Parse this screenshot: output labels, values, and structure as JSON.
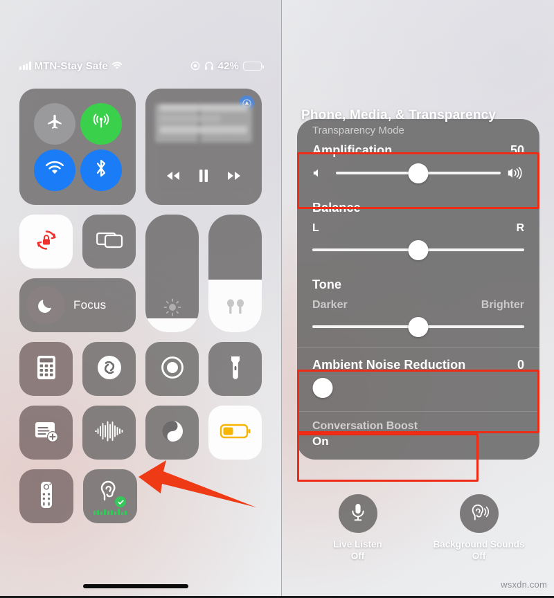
{
  "status_bar": {
    "carrier": "MTN-Stay Safe",
    "signal_icon": "cellular-signal-bars-icon",
    "wifi_icon": "wifi-icon",
    "record_icon": "screen-record-indicator-icon",
    "headphones_icon": "headphones-icon",
    "battery_percent": "42%",
    "battery_level": 42,
    "battery_color": "#fdc500"
  },
  "control_center": {
    "connectivity": {
      "airplane": {
        "name": "airplane-mode",
        "icon": "airplane-icon",
        "state": "off"
      },
      "cellular": {
        "name": "cellular-data",
        "icon": "cellular-antenna-icon",
        "state": "on"
      },
      "wifi": {
        "name": "wifi",
        "icon": "wifi-icon",
        "state": "on"
      },
      "bluetooth": {
        "name": "bluetooth",
        "icon": "bluetooth-icon",
        "state": "on"
      }
    },
    "media": {
      "airplay_icon": "airplay-audio-icon",
      "rewind_icon": "rewind-icon",
      "pause_icon": "pause-icon",
      "forward_icon": "fast-forward-icon",
      "artwork": "blurred-now-playing-artwork"
    },
    "rotation_lock": {
      "icon": "rotation-lock-icon",
      "state": "on"
    },
    "screen_mirroring": {
      "icon": "screen-mirroring-icon",
      "state": "off"
    },
    "focus": {
      "label": "Focus",
      "icon": "moon-icon",
      "state": "off"
    },
    "brightness": {
      "icon": "brightness-sun-icon",
      "level": 12
    },
    "volume": {
      "icon": "airpods-icon",
      "level": 45
    },
    "tiles": [
      {
        "label": "Calculator",
        "icon": "calculator-icon"
      },
      {
        "label": "Shazam",
        "icon": "shazam-icon"
      },
      {
        "label": "Screen Recording",
        "icon": "screen-record-icon"
      },
      {
        "label": "Flashlight",
        "icon": "flashlight-icon"
      },
      {
        "label": "Quick Note",
        "icon": "quick-note-icon"
      },
      {
        "label": "Sound Recognition",
        "icon": "sound-waveform-icon"
      },
      {
        "label": "Dark Mode",
        "icon": "dark-mode-icon"
      },
      {
        "label": "Low Power Mode",
        "icon": "low-power-battery-icon"
      },
      {
        "label": "Apple TV Remote",
        "icon": "apple-tv-remote-icon"
      },
      {
        "label": "Hearing",
        "icon": "hearing-ear-icon"
      }
    ],
    "hearing_tile": {
      "icon": "hearing-ear-icon",
      "badge_icon": "green-check-badge-icon",
      "meter": "audio-level-meter",
      "badge_color": "#35c759"
    },
    "pointer": {
      "icon": "red-arrow-pointer",
      "color": "#ee3a15",
      "points_at": "Hearing"
    }
  },
  "hearing_panel": {
    "header": "Phone, Media, & Transparency",
    "transparency_label": "Transparency Mode",
    "amplification": {
      "label": "Amplification",
      "value": "50",
      "level": 50,
      "icon_left": "volume-low-icon",
      "icon_right": "volume-high-icon"
    },
    "balance": {
      "label": "Balance",
      "left": "L",
      "right": "R",
      "level": 50
    },
    "tone": {
      "label": "Tone",
      "left": "Darker",
      "right": "Brighter",
      "level": 50
    },
    "ambient_noise_reduction": {
      "label": "Ambient Noise Reduction",
      "value": "0",
      "level": 0
    },
    "conversation_boost": {
      "label": "Conversation Boost",
      "value": "On"
    },
    "actions": [
      {
        "name": "Live Listen",
        "state": "Off",
        "icon": "microphone-icon"
      },
      {
        "name": "Background Sounds",
        "state": "Off",
        "icon": "hearing-sound-waves-icon"
      }
    ],
    "highlight_color": "#ee2b15"
  },
  "watermark": "wsxdn.com"
}
